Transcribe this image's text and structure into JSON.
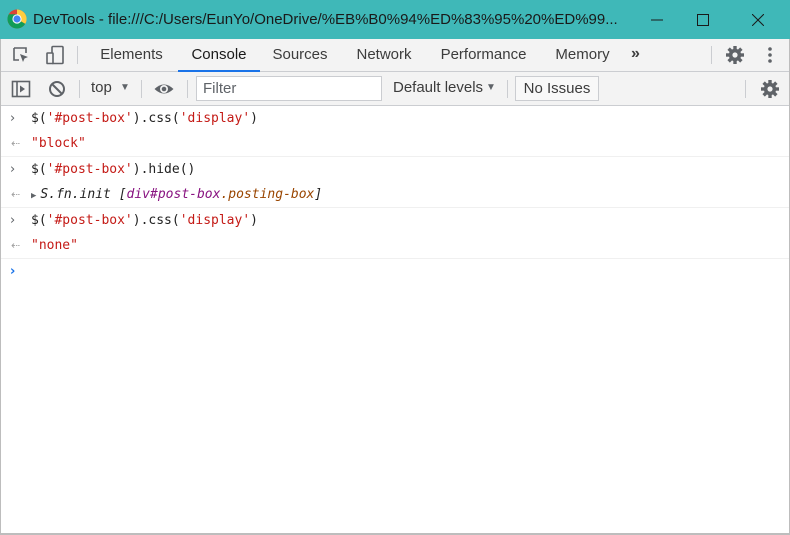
{
  "window": {
    "title": "DevTools - file:///C:/Users/EunYo/OneDrive/%EB%B0%94%ED%83%95%20%ED%99...",
    "accent_color": "#3fb8b8"
  },
  "tabs": [
    {
      "label": "Elements",
      "active": false
    },
    {
      "label": "Console",
      "active": true
    },
    {
      "label": "Sources",
      "active": false
    },
    {
      "label": "Network",
      "active": false
    },
    {
      "label": "Performance",
      "active": false
    },
    {
      "label": "Memory",
      "active": false
    }
  ],
  "more_tabs_label": "»",
  "toolbar": {
    "context": "top",
    "filter_placeholder": "Filter",
    "levels": "Default levels",
    "issues": "No Issues"
  },
  "console": [
    {
      "input": {
        "prefix": "$(",
        "arg": "'#post-box'",
        "mid": ").css(",
        "arg2": "'display'",
        "suffix": ")"
      },
      "output": {
        "type": "string",
        "text": "\"block\""
      }
    },
    {
      "input": {
        "prefix": "$(",
        "arg": "'#post-box'",
        "mid": ").hide()"
      },
      "output": {
        "type": "object",
        "ctor": "S.fn.init",
        "open": " [",
        "node": "div#post-box",
        "cls": ".posting-box",
        "close": "]"
      }
    },
    {
      "input": {
        "prefix": "$(",
        "arg": "'#post-box'",
        "mid": ").css(",
        "arg2": "'display'",
        "suffix": ")"
      },
      "output": {
        "type": "string",
        "text": "\"none\""
      }
    }
  ],
  "icons": {
    "inspect": "inspect-element-icon",
    "device": "device-toolbar-icon",
    "sidebar": "console-sidebar-icon",
    "clear": "clear-console-icon",
    "eye": "live-expression-icon",
    "settings": "gear-icon",
    "kebab": "more-vert-icon"
  }
}
